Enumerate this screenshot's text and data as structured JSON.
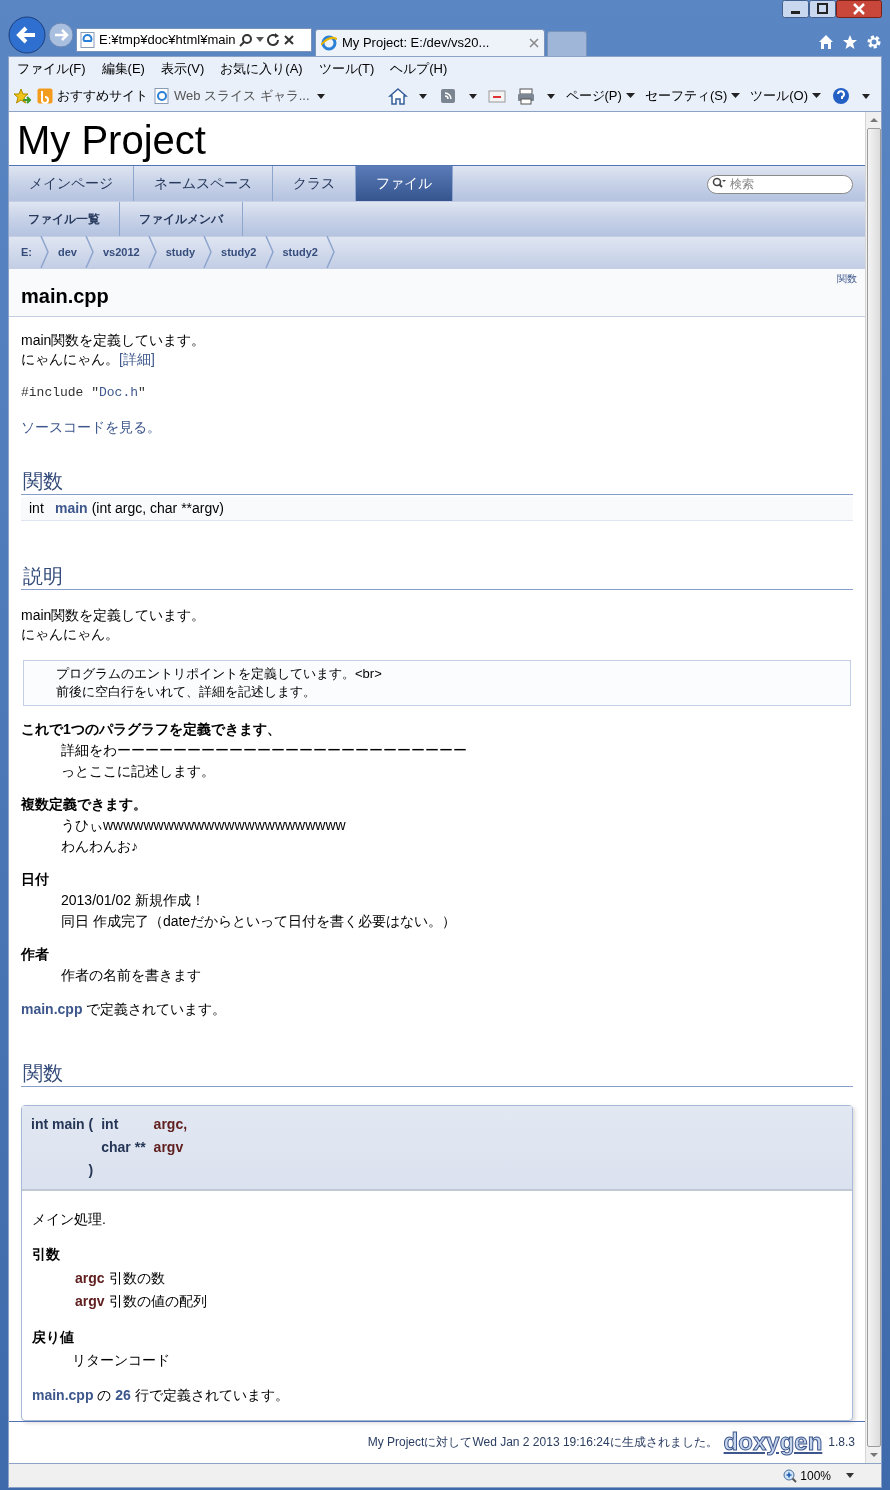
{
  "window": {
    "address": "E:¥tmp¥doc¥html¥main",
    "tabs": [
      {
        "label": "My Project: E:/dev/vs20...",
        "selected": true
      }
    ]
  },
  "menu": [
    "ファイル(F)",
    "編集(E)",
    "表示(V)",
    "お気に入り(A)",
    "ツール(T)",
    "ヘルプ(H)"
  ],
  "favorites": [
    "おすすめサイト",
    "Web スライス ギャラ..."
  ],
  "command_bar": [
    "ページ(P)",
    "セーフティ(S)",
    "ツール(O)"
  ],
  "page": {
    "project_name": "My Project",
    "main_tabs": [
      {
        "label": "メインページ",
        "selected": false
      },
      {
        "label": "ネームスペース",
        "selected": false
      },
      {
        "label": "クラス",
        "selected": false
      },
      {
        "label": "ファイル",
        "selected": true
      }
    ],
    "search": {
      "placeholder": "検索"
    },
    "sub_tabs": [
      "ファイル一覧",
      "ファイルメンバ"
    ],
    "breadcrumbs": [
      "E:",
      "dev",
      "vs2012",
      "study",
      "study2",
      "study2"
    ],
    "summary_links": [
      "関数"
    ],
    "title": "main.cpp",
    "brief": [
      "main関数を定義しています。",
      "にゃんにゃん。"
    ],
    "more_link": "[詳細]",
    "include": {
      "prefix": "#include \"",
      "file": "Doc.h",
      "suffix": "\""
    },
    "source_link": "ソースコードを見る。",
    "functions_heading": "関数",
    "member": {
      "type": "int",
      "name": "main",
      "args": "(int argc, char **argv)"
    },
    "description_heading": "説明",
    "description": [
      "main関数を定義しています。",
      "にゃんにゃん。"
    ],
    "verbatim": [
      "プログラムのエントリポイントを定義しています。<br>",
      "前後に空白行をいれて、詳細を記述します。"
    ],
    "sections": [
      {
        "title": "これで1つのパラグラフを定義できます、",
        "lines": [
          "詳細をわーーーーーーーーーーーーーーーーーーーーーーーーー",
          "っとここに記述します。"
        ]
      },
      {
        "title": "複数定義できます。",
        "lines": [
          "うひぃwwwwwwwwwwwwwwwwwwwwwwww",
          "わんわんお♪"
        ]
      },
      {
        "title": "日付",
        "lines": [
          "2013/01/02 新規作成！",
          "同日 作成完了（dateだからといって日付を書く必要はない。）"
        ]
      },
      {
        "title": "作者",
        "lines": [
          "作者の名前を書きます"
        ]
      }
    ],
    "defined_in": {
      "file": "main.cpp",
      "text": " で定義されています。"
    },
    "function_docs_heading": "関数",
    "function_doc": {
      "prototype": {
        "start": "int main (",
        "params": [
          {
            "type": "int",
            "name": "argc,"
          },
          {
            "type": "char **",
            "name": "argv"
          }
        ],
        "close": ")"
      },
      "brief": "メイン処理.",
      "params_title": "引数",
      "params": [
        {
          "name": "argc",
          "text": "引数の数"
        },
        {
          "name": "argv",
          "text": "引数の値の配列"
        }
      ],
      "return_title": "戻り値",
      "return_text": "リターンコード",
      "defined": {
        "file": "main.cpp",
        "mid": " の ",
        "line": "26",
        "end": " 行で定義されています。"
      }
    }
  },
  "footer": {
    "text": "My Projectに対してWed Jan 2 2013 19:16:24に生成されました。",
    "logo": "doxygen",
    "version": "1.8.3"
  },
  "status_bar": {
    "zoom": "100%"
  }
}
